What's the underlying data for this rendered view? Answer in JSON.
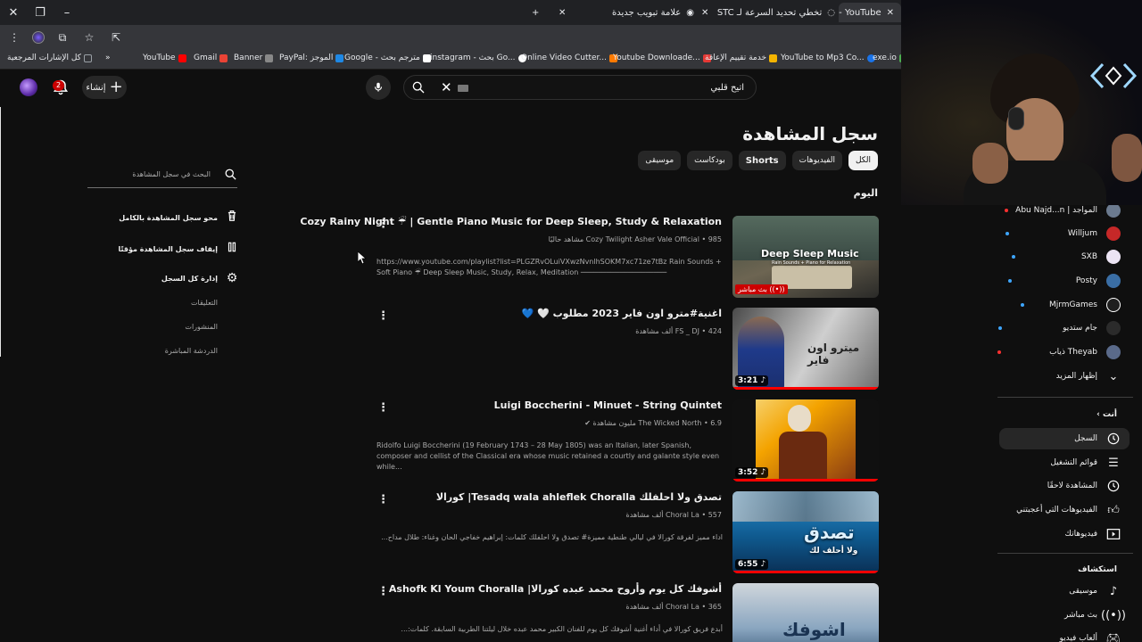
{
  "browser": {
    "tabs": [
      {
        "title": "علامة تبويب جديدة",
        "active": false
      },
      {
        "title": "تخطي تحديد السرعة لـ STC",
        "active": false
      },
      {
        "title": "YouTube -",
        "active": true
      }
    ],
    "bookmarks": [
      {
        "label": "كل الإشارات المرجعية",
        "color": "#9aa0a6"
      },
      {
        "label": "YouTube",
        "color": "#ff0000"
      },
      {
        "label": "Gmail",
        "color": "#ea4335"
      },
      {
        "label": "Banner",
        "color": "#888888"
      },
      {
        "label": "PayPal: الموجز",
        "color": "#1e88e5"
      },
      {
        "label": "Google - مترجم بحث",
        "color": "#ffffff"
      },
      {
        "label": "instagram - بحث Go...",
        "color": "#ffffff"
      },
      {
        "label": "Online Video Cutter...",
        "color": "#ff7a00"
      },
      {
        "label": "Youtube Downloade...",
        "color": "#e53935"
      },
      {
        "label": "خدمة تقييم الإعاقة",
        "color": "#f4b400"
      },
      {
        "label": "YouTube to Mp3 Co...",
        "color": "#1a73e8"
      },
      {
        "label": "exe.io",
        "color": "#4caf50"
      }
    ]
  },
  "header": {
    "create_label": "إنشاء",
    "notification_count": "2",
    "search_value": "اتيح قلبي"
  },
  "main": {
    "page_title": "سجل المشاهدة",
    "chips": [
      "الكل",
      "الفيديوهات",
      "Shorts",
      "بودكاست",
      "موسيقى"
    ],
    "section_label": "اليوم",
    "videos": [
      {
        "title": "Cozy Rainy Night ☔ | Gentle Piano Music for Deep Sleep, Study & Relaxation",
        "meta": "Cozy Twilight Asher Vale Official • 985 مشاهد حاليًا",
        "desc": "https://www.youtube.com/playlist?list=PLGZRvOLuiVXwzNvnlhSOKM7xc71ze7tBz Rain Sounds + Soft Piano ☔ Deep Sleep Music, Study, Relax, Meditation ────────────────────",
        "desc_rtl": false,
        "badge": "بث مباشر",
        "overlay": "Deep Sleep Music",
        "overlay_sub": "Rain Sounds + Piano for Relaxation",
        "colors": [
          "#3c4a3e",
          "#6d6552",
          "#2a2a28"
        ]
      },
      {
        "title": "اغنية#مترو اون فاير 2023 مطلوب 🤍 💙",
        "meta": "FS _ DJ • 424 ألف مشاهدة",
        "desc": "",
        "desc_rtl": true,
        "duration": "3:21",
        "overlay": "ميترو اون فاير",
        "progress": 1.0,
        "colors": [
          "#6e6e6e",
          "#d9d9d9",
          "#3a3a3a"
        ]
      },
      {
        "title": "Luigi Boccherini - Minuet - String Quintet",
        "meta": "The Wicked North • 6.9 مليون مشاهدة",
        "desc": "Ridolfo Luigi Boccherini (19 February 1743 – 28 May 1805) was an Italian, later Spanish, composer and cellist of the Classical era whose music retained a courtly and galante style even while...",
        "desc_rtl": false,
        "duration": "3:52",
        "progress": 1.0,
        "colors": [
          "#f4a300",
          "#8a3b12",
          "#f6d06a"
        ]
      },
      {
        "title": "تصدق ولا احلفلك Tesadq wala ahleflek Choralla| كورالا",
        "meta": "Choral La • 557 ألف مشاهدة",
        "desc": "اداء مميز لفرقة كورالا في ليالي طنطية مميزة# تصدق ولا احلفلك كلمات: إبراهيم خفاجي الحان وغناء: طلال مداح...",
        "desc_rtl": true,
        "duration": "6:55",
        "overlay": "تصدق",
        "overlay_sub": "ولا أحلف لك",
        "progress": 1.0,
        "colors": [
          "#0f5a8f",
          "#2c8fcf",
          "#0a2f55"
        ]
      },
      {
        "title": "أشوفك كل يوم وأروح محمد عبده كورالا| Ashofk Kl Youm Choralla",
        "meta": "Choral La • 365 ألف مشاهدة",
        "desc": "أبدع فريق كورالا في أداء أغنية أشوفك كل يوم للفنان الكبير محمد عبده خلال ليلتنا الطربية السابقة. كلمات:...",
        "desc_rtl": true,
        "overlay": "اشوفك",
        "colors": [
          "#d0d6dc",
          "#8aa6c0",
          "#2a4a6a"
        ]
      }
    ]
  },
  "history_panel": {
    "search_placeholder": "البحث في سجل المشاهدة",
    "clear_label": "محو سجل المشاهدة بالكامل",
    "pause_label": "إيقاف سجل المشاهدة مؤقتًا",
    "manage_label": "إدارة كل السجل",
    "sub_comments": "التعليقات",
    "sub_posts": "المنشورات",
    "sub_live_chat": "الدردشة المباشرة"
  },
  "sidebar": {
    "subscriptions": [
      {
        "label": "المواجد | Abu Najd...n",
        "color": "#6b7a8f"
      },
      {
        "label": "Willjum",
        "color": "#c62828"
      },
      {
        "label": "SXB",
        "color": "#ece4f4"
      },
      {
        "label": "Posty",
        "color": "#3a6ea5"
      },
      {
        "label": "MjrmGames",
        "color": "#1f1f1f"
      },
      {
        "label": "جام ستديو",
        "color": "#2b2b2b"
      },
      {
        "label": "Theyab ذياب",
        "color": "#5a6a8a"
      }
    ],
    "show_more": "إظهار المزيد",
    "you_heading": "أنت",
    "you_items": [
      {
        "label": "السجل",
        "icon": "history-icon",
        "active": true
      },
      {
        "label": "قوائم التشغيل",
        "icon": "playlist-icon",
        "active": false
      },
      {
        "label": "المشاهدة لاحقًا",
        "icon": "clock-icon",
        "active": false
      },
      {
        "label": "الفيديوهات التي أعجبتني",
        "icon": "thumb-up-icon",
        "active": false
      },
      {
        "label": "فيديوهاتك",
        "icon": "your-videos-icon",
        "active": false
      }
    ],
    "explore_heading": "استكشاف",
    "explore_items": [
      {
        "label": "موسيقى",
        "icon": "music-icon"
      },
      {
        "label": "بث مباشر",
        "icon": "live-icon"
      },
      {
        "label": "ألعاب فيديو",
        "icon": "gaming-icon"
      }
    ]
  }
}
